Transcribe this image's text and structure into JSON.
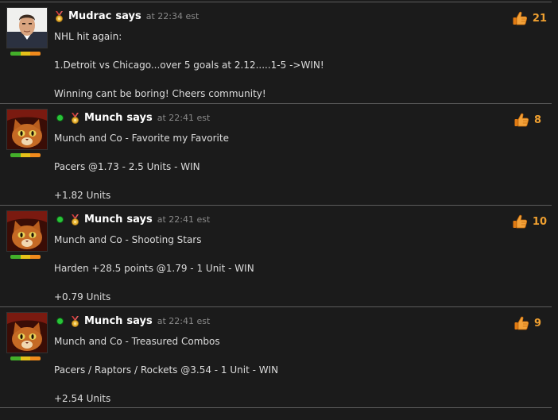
{
  "posts": [
    {
      "author": "Mudrac",
      "says": "says",
      "time": "at 22:34 est",
      "online": false,
      "likes": "21",
      "lines": [
        "NHL hit again:",
        "1.Detroit vs Chicago...over 5 goals at 2.12.....1-5 ->WIN!",
        "Winning cant be boring! Cheers community!"
      ]
    },
    {
      "author": "Munch",
      "says": "says",
      "time": "at 22:41 est",
      "online": true,
      "likes": "8",
      "lines": [
        "Munch and Co - Favorite my Favorite",
        "Pacers @1.73 - 2.5 Units - WIN",
        "+1.82 Units"
      ]
    },
    {
      "author": "Munch",
      "says": "says",
      "time": "at 22:41 est",
      "online": true,
      "likes": "10",
      "lines": [
        "Munch and Co - Shooting Stars",
        "Harden +28.5 points @1.79 - 1 Unit - WIN",
        "+0.79 Units"
      ]
    },
    {
      "author": "Munch",
      "says": "says",
      "time": "at 22:41 est",
      "online": true,
      "likes": "9",
      "lines": [
        "Munch and Co - Treasured Combos",
        "Pacers / Raptors / Rockets @3.54 - 1 Unit - WIN",
        "+2.54 Units"
      ]
    }
  ],
  "icons": {
    "like": "thumbs-up-icon",
    "medal": "medal-icon",
    "online": "online-status-icon"
  },
  "colors": {
    "background": "#1b1b1b",
    "likes": "#f0a030",
    "online": "#29c43a"
  }
}
